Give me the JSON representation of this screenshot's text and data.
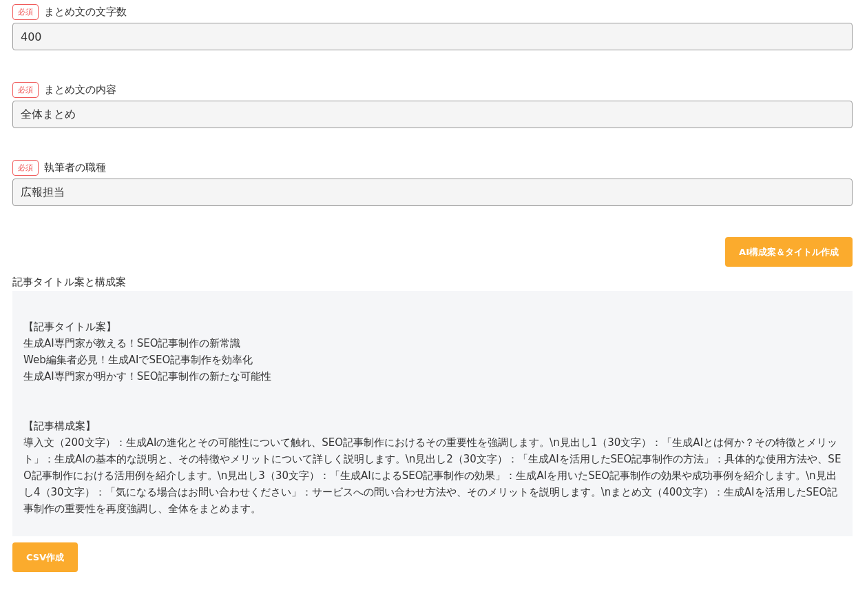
{
  "fields": [
    {
      "badge": "必須",
      "label": "まとめ文の文字数",
      "value": "400"
    },
    {
      "badge": "必須",
      "label": "まとめ文の内容",
      "value": "全体まとめ"
    },
    {
      "badge": "必須",
      "label": "執筆者の職種",
      "value": "広報担当"
    }
  ],
  "generate_button": "AI構成案＆タイトル作成",
  "output": {
    "label": "記事タイトル案と構成案",
    "sections": [
      {
        "heading": "【記事タイトル案】",
        "lines": [
          "生成AI専門家が教える！SEO記事制作の新常識",
          "Web編集者必見！生成AIでSEO記事制作を効率化",
          "生成AI専門家が明かす！SEO記事制作の新たな可能性"
        ]
      },
      {
        "heading": "【記事構成案】",
        "lines": [
          "導入文（200文字）：生成AIの進化とその可能性について触れ、SEO記事制作におけるその重要性を強調します。\\n見出し1（30文字）：「生成AIとは何か？その特徴とメリット」：生成AIの基本的な説明と、その特徴やメリットについて詳しく説明します。\\n見出し2（30文字）：「生成AIを活用したSEO記事制作の方法」：具体的な使用方法や、SEO記事制作における活用例を紹介します。\\n見出し3（30文字）：「生成AIによるSEO記事制作の効果」：生成AIを用いたSEO記事制作の効果や成功事例を紹介します。\\n見出し4（30文字）：「気になる場合はお問い合わせください」：サービスへの問い合わせ方法や、そのメリットを説明します。\\nまとめ文（400文字）：生成AIを活用したSEO記事制作の重要性を再度強調し、全体をまとめます。"
        ]
      }
    ]
  },
  "csv_button": "CSV作成"
}
